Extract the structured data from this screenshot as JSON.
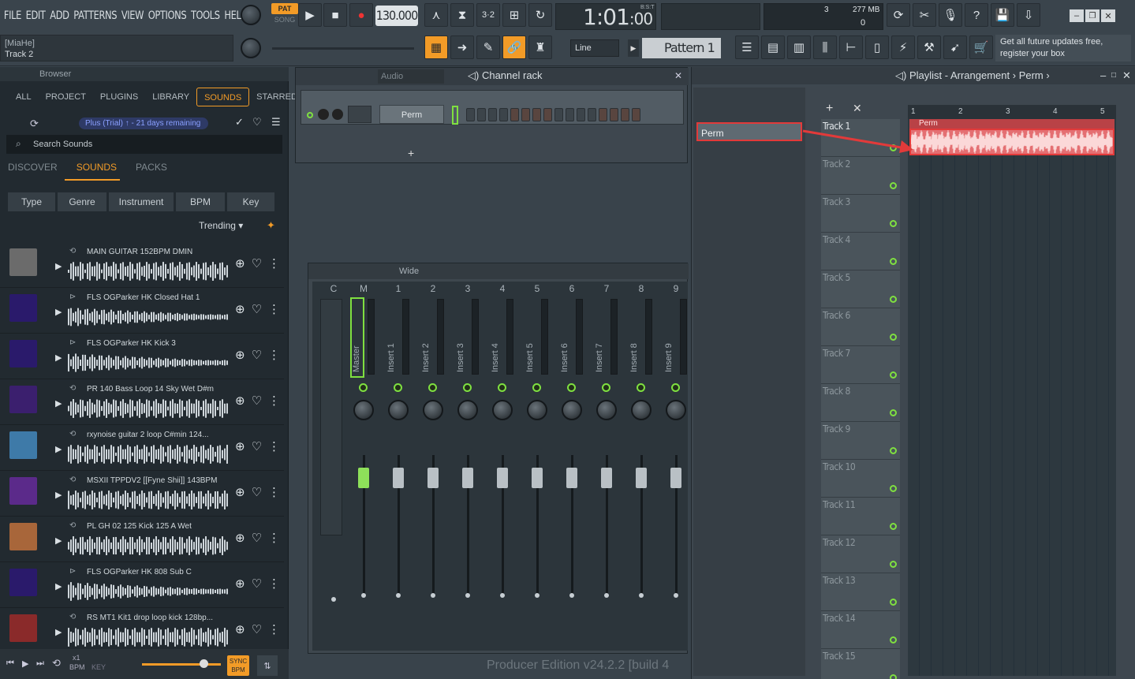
{
  "menu": [
    "FILE",
    "EDIT",
    "ADD",
    "PATTERNS",
    "VIEW",
    "OPTIONS",
    "TOOLS",
    "HELP"
  ],
  "hint": {
    "line1": "[MiaHe]",
    "line2": "Track 2"
  },
  "transport": {
    "pat": "PAT",
    "song": "SONG",
    "tempo": "130.000",
    "time": "1:01",
    "time_sub": ":00",
    "bst": "B:S:T"
  },
  "cpu": {
    "value": "3",
    "memory": "277 MB",
    "poly": "0"
  },
  "snap": "Line",
  "pattern": "Pattern 1",
  "ad": {
    "line1": "Get all future updates free,",
    "line2": "register your box"
  },
  "browser": {
    "title": "Browser",
    "tabs": [
      "ALL",
      "PROJECT",
      "PLUGINS",
      "LIBRARY",
      "SOUNDS",
      "STARRED"
    ],
    "trial": "Plus (Trial) ↑ - 21 days remaining",
    "search_placeholder": "Search Sounds",
    "subtabs": [
      "DISCOVER",
      "SOUNDS",
      "PACKS"
    ],
    "filters": [
      "Type",
      "Genre",
      "Instrument",
      "BPM",
      "Key"
    ],
    "sort": "Trending",
    "items": [
      {
        "title": "MAIN GUITAR 152BPM DMIN",
        "color": "#6b6b6b"
      },
      {
        "title": "FLS OGParker HK Closed Hat 1",
        "color": "#2a1a6b"
      },
      {
        "title": "FLS OGParker HK Kick 3",
        "color": "#2a1a6b"
      },
      {
        "title": "PR 140 Bass Loop 14 Sky Wet D#m",
        "color": "#3b1f6e"
      },
      {
        "title": "rxynoise guitar 2 loop C#min 124...",
        "color": "#3e7aa8"
      },
      {
        "title": "MSXII TPPDV2 [[Fyne Shii]] 143BPM",
        "color": "#5b2a8a"
      },
      {
        "title": "PL GH 02 125 Kick 125 A Wet",
        "color": "#a8663a"
      },
      {
        "title": "FLS OGParker HK 808 Sub C",
        "color": "#2a1a6b"
      },
      {
        "title": "RS MT1 Kit1 drop loop kick 128bp...",
        "color": "#8a2a2a"
      }
    ],
    "footer": {
      "bpm_label": "x1",
      "bpm": "BPM",
      "key": "KEY",
      "sync": "SYNC",
      "sync2": "BPM"
    }
  },
  "channel_rack": {
    "title": "Channel rack",
    "audio": "Audio",
    "channel": "Perm"
  },
  "mixer": {
    "title": "Wide",
    "strips": [
      {
        "num": "C",
        "label": ""
      },
      {
        "num": "M",
        "label": "Master"
      },
      {
        "num": "1",
        "label": "Insert 1"
      },
      {
        "num": "2",
        "label": "Insert 2"
      },
      {
        "num": "3",
        "label": "Insert 3"
      },
      {
        "num": "4",
        "label": "Insert 4"
      },
      {
        "num": "5",
        "label": "Insert 5"
      },
      {
        "num": "6",
        "label": "Insert 6"
      },
      {
        "num": "7",
        "label": "Insert 7"
      },
      {
        "num": "8",
        "label": "Insert 8"
      },
      {
        "num": "9",
        "label": "Insert 9"
      }
    ],
    "scale": [
      "3",
      "0",
      "3",
      "6",
      "9",
      "12",
      "15",
      "18",
      "21",
      "24",
      "27",
      "30",
      "33",
      "36"
    ]
  },
  "playlist": {
    "title": "Playlist - Arrangement",
    "breadcrumb": "Perm",
    "clip_pick": "Perm",
    "clip_name": "Perm",
    "ruler": [
      "1",
      "2",
      "3",
      "4",
      "5"
    ],
    "tracks": [
      "Track 1",
      "Track 2",
      "Track 3",
      "Track 4",
      "Track 5",
      "Track 6",
      "Track 7",
      "Track 8",
      "Track 9",
      "Track 10",
      "Track 11",
      "Track 12",
      "Track 13",
      "Track 14",
      "Track 15"
    ]
  },
  "watermark": "Producer Edition v24.2.2 [build 4",
  "colors": {
    "accent": "#f29b27",
    "highlight": "#e23a3a",
    "led": "#7fe040",
    "clip": "#e46f72"
  }
}
